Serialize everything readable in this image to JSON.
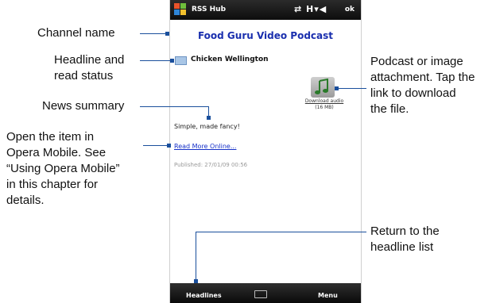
{
  "phone": {
    "app_title": "RSS Hub",
    "status_icons": "⇄ H▾◀",
    "ok_label": "ok",
    "channel_name": "Food Guru Video Podcast",
    "headline": "Chicken Wellington",
    "attachment": {
      "link_text": "Download audio",
      "size": "(16 MB)"
    },
    "summary": "Simple, made fancy!",
    "read_more": "Read More Online...",
    "published": "Published: 27/01/09 00:56",
    "softkeys": {
      "left": "Headlines",
      "right": "Menu"
    }
  },
  "callouts": {
    "channel_name": "Channel name",
    "headline_status": [
      "Headline and",
      "read status"
    ],
    "news_summary": "News summary",
    "open_item": [
      "Open the item in",
      "Opera Mobile. See",
      "“Using Opera Mobile”",
      "in this chapter for",
      "details."
    ],
    "attachment": [
      "Podcast or image",
      "attachment. Tap the",
      "link to download",
      "the file."
    ],
    "return": [
      "Return to the",
      "headline list"
    ]
  },
  "colors": {
    "leader": "#1a4f9c",
    "channel_title": "#1a2fae",
    "link": "#1530c8"
  }
}
